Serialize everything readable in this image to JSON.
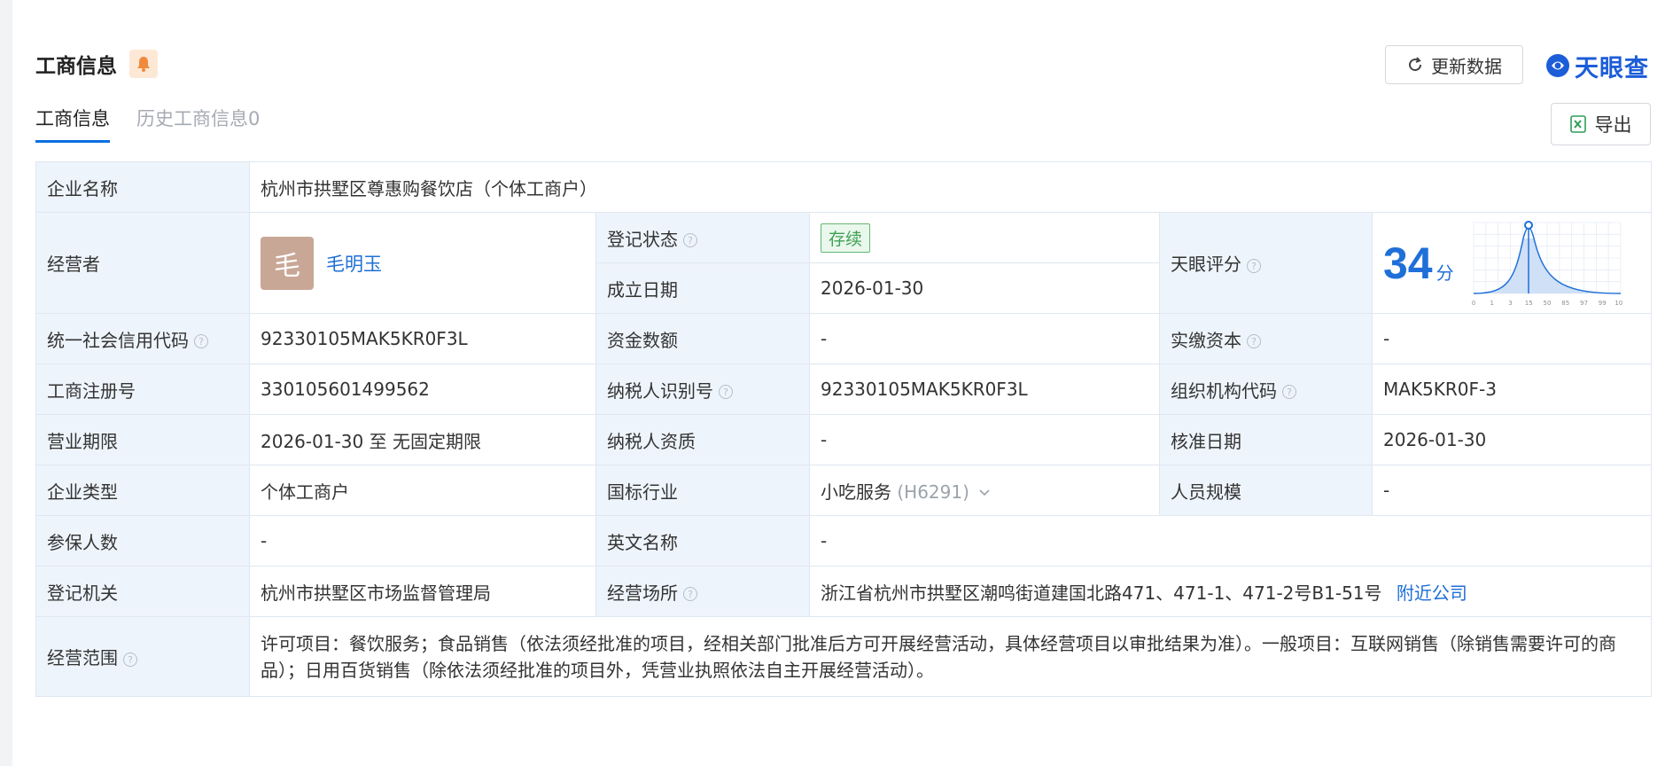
{
  "header": {
    "title": "工商信息",
    "refresh_label": "更新数据",
    "brand": "天眼查"
  },
  "tabs": [
    {
      "label": "工商信息"
    },
    {
      "label": "历史工商信息0"
    }
  ],
  "export_label": "导出",
  "table": {
    "company_name_label": "企业名称",
    "company_name": "杭州市拱墅区尊惠购餐饮店（个体工商户）",
    "operator_label": "经营者",
    "operator_avatar": "毛",
    "operator_name": "毛明玉",
    "reg_status_label": "登记状态",
    "reg_status": "存续",
    "est_date_label": "成立日期",
    "est_date": "2026-01-30",
    "score_label": "天眼评分",
    "score_value": "34",
    "score_unit": "分",
    "credit_code_label": "统一社会信用代码",
    "credit_code": "92330105MAK5KR0F3L",
    "capital_label": "资金数额",
    "capital": "-",
    "paid_capital_label": "实缴资本",
    "paid_capital": "-",
    "reg_no_label": "工商注册号",
    "reg_no": "330105601499562",
    "taxpayer_id_label": "纳税人识别号",
    "taxpayer_id": "92330105MAK5KR0F3L",
    "org_code_label": "组织机构代码",
    "org_code": "MAK5KR0F-3",
    "term_label": "营业期限",
    "term": "2026-01-30 至 无固定期限",
    "taxpayer_qual_label": "纳税人资质",
    "taxpayer_qual": "-",
    "approve_date_label": "核准日期",
    "approve_date": "2026-01-30",
    "type_label": "企业类型",
    "type": "个体工商户",
    "industry_label": "国标行业",
    "industry": "小吃服务",
    "industry_code": "(H6291)",
    "staff_label": "人员规模",
    "staff": "-",
    "insured_label": "参保人数",
    "insured": "-",
    "english_label": "英文名称",
    "english": "-",
    "authority_label": "登记机关",
    "authority": "杭州市拱墅区市场监督管理局",
    "address_label": "经营场所",
    "address": "浙江省杭州市拱墅区潮鸣街道建国北路471、471-1、471-2号B1-51号",
    "nearby_link": "附近公司",
    "scope_label": "经营范围",
    "scope": "许可项目：餐饮服务；食品销售（依法须经批准的项目，经相关部门批准后方可开展经营活动，具体经营项目以审批结果为准）。一般项目：互联网销售（除销售需要许可的商品）；日用百货销售（除依法须经批准的项目外，凭营业执照依法自主开展经营活动）。"
  },
  "score_chart": {
    "tick_labels": [
      "0",
      "1",
      "3",
      "15",
      "50",
      "85",
      "97",
      "99",
      "100"
    ],
    "accent": "#1f6fd8"
  }
}
